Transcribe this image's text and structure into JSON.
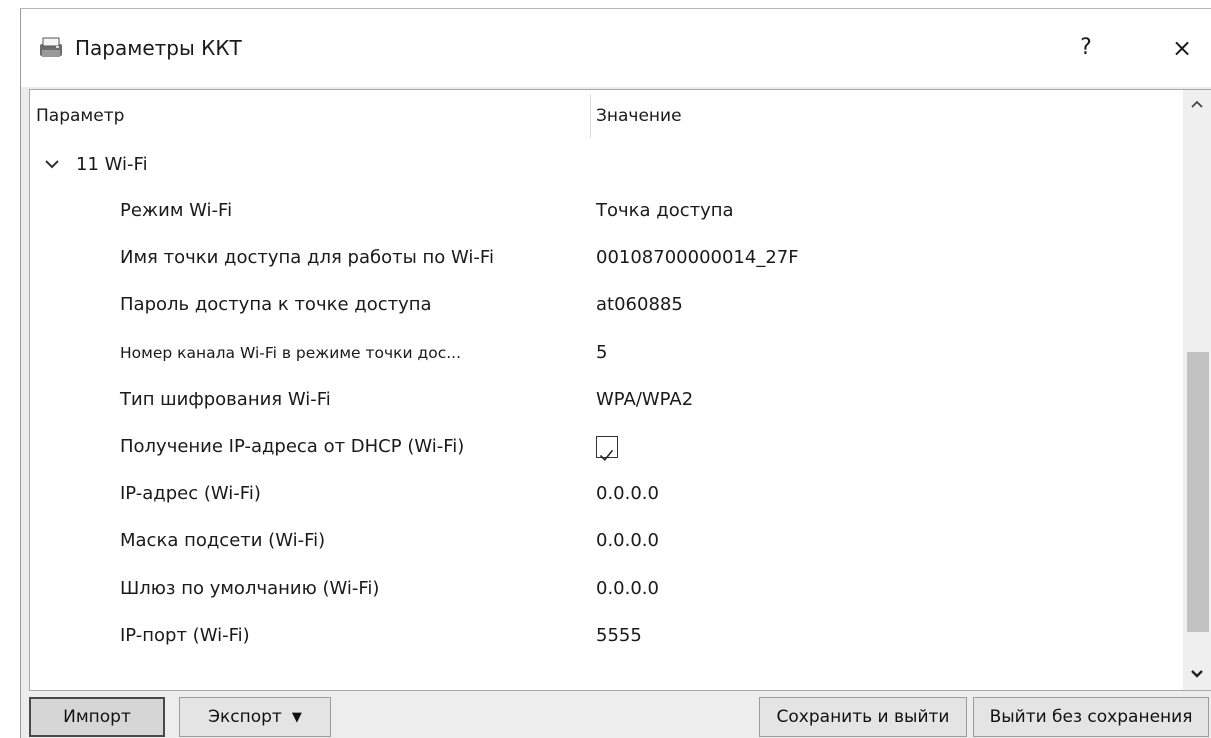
{
  "window": {
    "title": "Параметры ККТ",
    "help_label": "?",
    "close_label": "×"
  },
  "tree": {
    "headers": {
      "param": "Параметр",
      "value": "Значение"
    },
    "group": {
      "label": "11 Wi-Fi",
      "expanded": true
    },
    "rows": [
      {
        "name": "Режим Wi-Fi",
        "value": "Точка доступа",
        "type": "text"
      },
      {
        "name": "Имя точки доступа для работы по Wi-Fi",
        "value": "00108700000014_27F",
        "type": "text"
      },
      {
        "name": "Пароль доступа к точке доступа",
        "value": "at060885",
        "type": "text"
      },
      {
        "name": "Номер канала Wi-Fi в режиме точки дос...",
        "value": "5",
        "type": "text"
      },
      {
        "name": "Тип шифрования Wi-Fi",
        "value": "WPA/WPA2",
        "type": "text"
      },
      {
        "name": "Получение IP-адреса от DHCP (Wi-Fi)",
        "value": "",
        "type": "checkbox",
        "checked": true
      },
      {
        "name": "IP-адрес (Wi-Fi)",
        "value": "0.0.0.0",
        "type": "text"
      },
      {
        "name": "Маска подсети (Wi-Fi)",
        "value": "0.0.0.0",
        "type": "text"
      },
      {
        "name": "Шлюз по умолчанию (Wi-Fi)",
        "value": "0.0.0.0",
        "type": "text"
      },
      {
        "name": "IP-порт (Wi-Fi)",
        "value": "5555",
        "type": "text"
      }
    ]
  },
  "buttons": {
    "import": "Импорт",
    "export": "Экспорт",
    "save_exit": "Сохранить и выйти",
    "exit_no_save": "Выйти без сохранения"
  }
}
